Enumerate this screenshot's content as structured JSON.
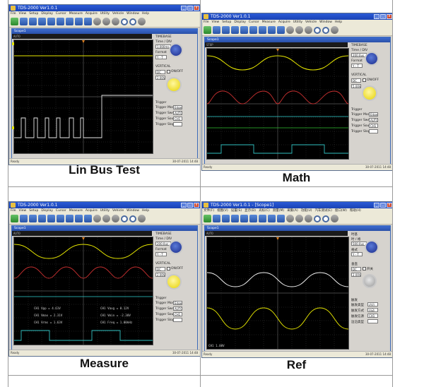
{
  "captions": {
    "lin": "Lin Bus Test",
    "math": "Math",
    "measure": "Measure",
    "ref": "Ref"
  },
  "app": {
    "title": "TDS-2000 Ver1.0.1",
    "title_cn": "TDS-2000 Ver1.0.1 - [Scope1]",
    "subwindow": "Scope1",
    "menu_en": [
      "File",
      "View",
      "Setup",
      "Display",
      "Cursor",
      "Measure",
      "Acquire",
      "Utility",
      "Vehicle",
      "Window",
      "Help"
    ],
    "menu_cn": [
      "文件(F)",
      "视图(V)",
      "设置(S)",
      "显示(D)",
      "光标(C)",
      "测量(M)",
      "采集(A)",
      "功能(U)",
      "汽车测试(E)",
      "窗口(W)",
      "帮助(H)"
    ],
    "statusbar_left": "Ready",
    "statusbar_date": "30-07-2011   14:48"
  },
  "panel_en": {
    "timebase_label": "TIMEBASE",
    "time_div_label": "Time / DIV",
    "time_div_value": "1.000ms",
    "time_div_value_math": "200.0us",
    "format_label": "Format",
    "format_value": "Y - T",
    "vertical_label": "VERTICAL",
    "volt_value": "2.00V",
    "math_volt_value": "5.00V",
    "coupling_value": "DC",
    "onoff_label": "ON/OFF",
    "trigger_label": "Trigger",
    "trigger_mode_label": "Trigger Mode",
    "trigger_mode_value": "Edge",
    "trigger_sweep_label": "Trigger Sweep",
    "trigger_sweep_value": "AUTO",
    "trigger_source_label": "Trigger Source",
    "trigger_source_value": "CH1",
    "trigger_slope_label": "Trigger Slope"
  },
  "panel_cn": {
    "timebase_label": "时基",
    "time_div_label": "时 / 格",
    "time_div_value": "500.0us",
    "format_label": "格式",
    "format_value": "Y - T",
    "vertical_label": "垂直",
    "volt_value": "2.00V",
    "coupling_value": "DC",
    "onoff_label": "开关",
    "trigger_label": "触发",
    "trigger_mode_label": "触发类型",
    "trigger_mode_value": "边沿",
    "trigger_sweep_label": "触发方式",
    "trigger_sweep_value": "自动",
    "trigger_source_label": "触发信源",
    "trigger_source_value": "CH1",
    "trigger_slope_label": "边沿类型"
  },
  "measurements": [
    "CH1 Vpp = 4.61V",
    "CH1 Vavg = 0.12V",
    "CH1 Vmax = 2.31V",
    "CH1 Vmin = -2.30V",
    "CH1 Vrms = 1.63V",
    "CH1 Freq = 1.00kHz"
  ],
  "screen_labels": {
    "lin_status": "AUTO",
    "math_status": "STOP",
    "ref_status": "AUTO",
    "ref_bottom": "CH1 1.00V"
  },
  "colors": {
    "ch1_yellow": "#e6e600",
    "ch2_white": "#f0f0f0",
    "math_red": "#c83030",
    "ch_cyan": "#30d0d0",
    "ch_green": "#30c030",
    "grid": "#3a3a3a"
  }
}
